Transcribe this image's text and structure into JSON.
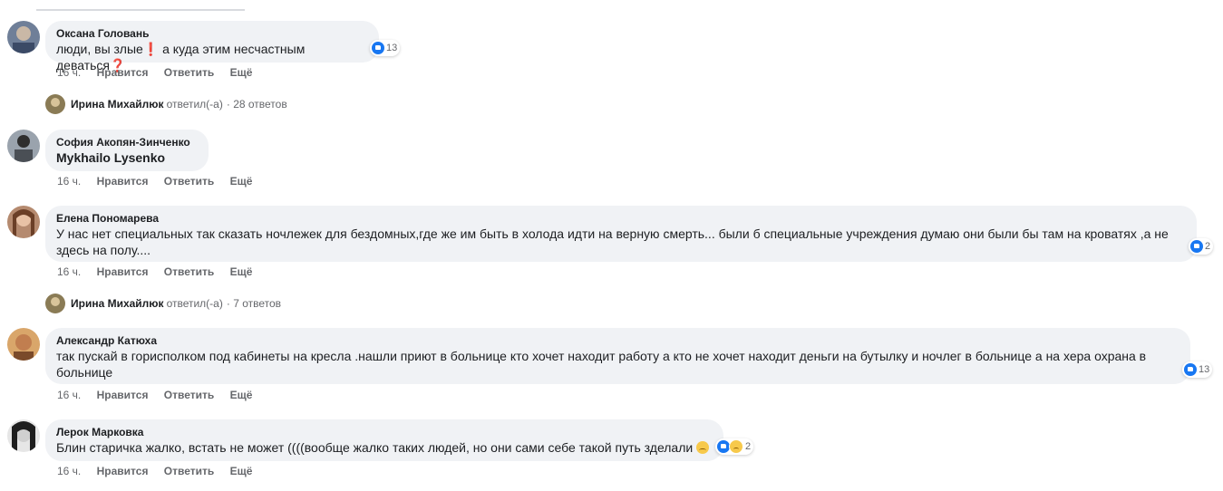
{
  "comments": [
    {
      "author": "Оксана Головань",
      "text": "люди, вы злые❗ а куда этим несчастным деваться❓",
      "time": "16 ч.",
      "likes": "13"
    },
    {
      "author": "София Акопян-Зинченко",
      "text": "Mykhailo Lysenko",
      "time": "16 ч."
    },
    {
      "author": "Елена Пономарева",
      "text_line1": "У нас нет специальных так сказать ночлежек для бездомных,где же им быть в холода идти на верную смерть... были б специальные учреждения думаю они были бы там на кроватях ,а не",
      "text_line2": "здесь на полу....",
      "time": "16 ч.",
      "likes": "2"
    },
    {
      "author": "Александр Катюха",
      "text_line1": "так пускай в горисполком под кабинеты на кресла .нашли приют в больнице кто хочет находит работу а кто не хочет находит деньги на бутылку и ночлег в больнице а на хера охрана в",
      "text_line2": "больнице",
      "time": "16 ч.",
      "likes": "13"
    },
    {
      "author": "Лерок Марковка",
      "text": "Блин старичка жалко, встать не может ((((вообще жалко таких людей, но они сами себе такой путь зделали",
      "time": "16 ч.",
      "likes": "2"
    }
  ],
  "actions": {
    "like": "Нравится",
    "reply": "Ответить",
    "more": "Ещё"
  },
  "replies": [
    {
      "name": "Ирина Михайлюк",
      "verb": "ответил(-а)",
      "count": "· 28 ответов"
    },
    {
      "name": "Ирина Михайлюк",
      "verb": "ответил(-а)",
      "count": "· 7 ответов"
    }
  ],
  "colors": {
    "bubble": "#f0f2f5",
    "meta": "#65676b",
    "like_blue": "#1877f2"
  },
  "icons": [
    "like-icon",
    "sad-icon",
    "emoji-icon",
    "avatar"
  ]
}
